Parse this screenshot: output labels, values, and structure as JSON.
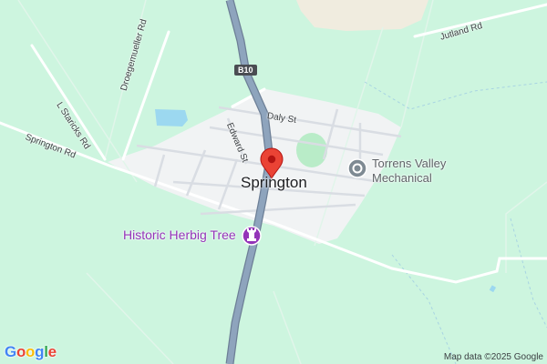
{
  "map": {
    "town": "Springton",
    "road_shield": "B10",
    "roads": {
      "jutland": "Jutland Rd",
      "droegemueller": "Droegemueller Rd",
      "l_staricks": "L Staricks Rd",
      "springton": "Springton Rd",
      "edward": "Edward St",
      "daly": "Daly St"
    },
    "pois": {
      "torrens_line1": "Torrens Valley",
      "torrens_line2": "Mechanical",
      "herbig": "Historic Herbig Tree"
    },
    "attribution": "Map data ©2025 Google",
    "logo": {
      "letters": [
        "G",
        "o",
        "o",
        "g",
        "l",
        "e"
      ],
      "colors": [
        "#4285f4",
        "#ea4335",
        "#fbbc05",
        "#4285f4",
        "#34a853",
        "#ea4335"
      ]
    },
    "colors": {
      "land": "#cdf5df",
      "urban": "#f1f3f4",
      "water": "#9cd8f0",
      "highway": "#8ea4bd",
      "pin": "#ea4335",
      "poi_purple": "#9334b8"
    }
  }
}
